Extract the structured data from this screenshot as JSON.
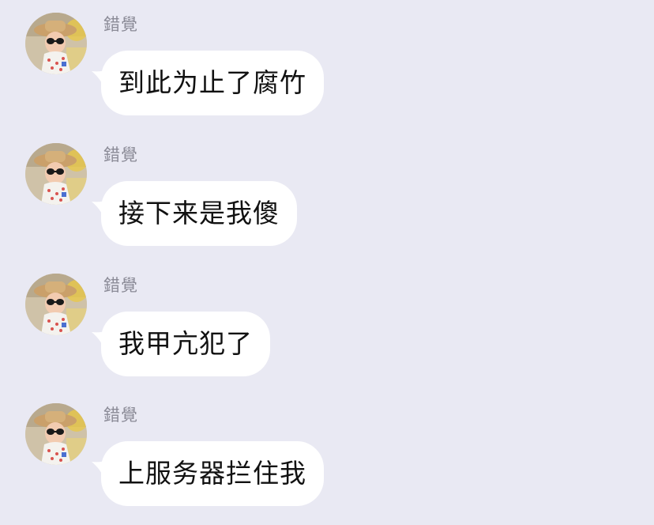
{
  "chat": {
    "messages": [
      {
        "sender": "錯覺",
        "text": "到此为止了腐竹",
        "avatar_icon": "user-avatar-photo"
      },
      {
        "sender": "錯覺",
        "text": "接下来是我傻",
        "avatar_icon": "user-avatar-photo"
      },
      {
        "sender": "錯覺",
        "text": "我甲亢犯了",
        "avatar_icon": "user-avatar-photo"
      },
      {
        "sender": "錯覺",
        "text": "上服务器拦住我",
        "avatar_icon": "user-avatar-photo"
      }
    ]
  },
  "colors": {
    "background": "#e9e9f3",
    "bubble": "#ffffff",
    "sender_name": "#8a8a96",
    "message_text": "#111111"
  }
}
